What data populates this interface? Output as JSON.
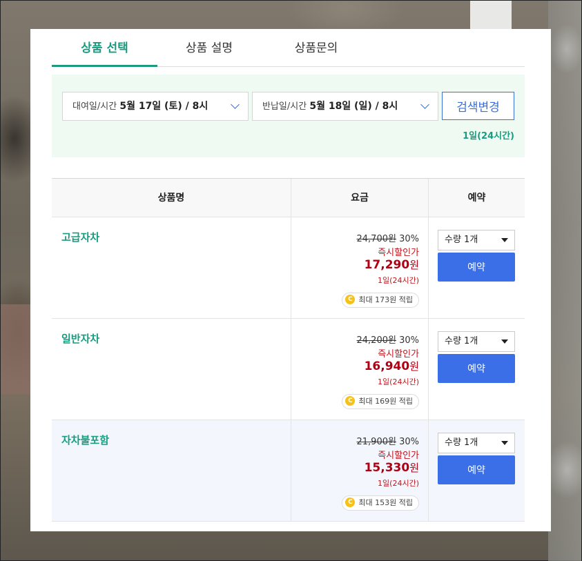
{
  "tabs": [
    {
      "label": "상품 선택"
    },
    {
      "label": "상품 설명"
    },
    {
      "label": "상품문의"
    }
  ],
  "search": {
    "from_label": "대여일/시간",
    "from_value": "5월 17일 (토) / 8시",
    "to_label": "반납일/시간",
    "to_value": "5월 18일 (일) / 8시",
    "change_button": "검색변경",
    "duration": "1일(24시간)"
  },
  "table": {
    "headers": [
      "상품명",
      "요금",
      "예약"
    ],
    "rows": [
      {
        "name": "고급자차",
        "original_price": "24,700원",
        "discount": "30%",
        "instant_label": "즉시할인가",
        "price": "17,290",
        "won": "원",
        "duration": "1일(24시간)",
        "points": "최대 173원 적립",
        "qty": "수량 1개",
        "book": "예약"
      },
      {
        "name": "일반자차",
        "original_price": "24,200원",
        "discount": "30%",
        "instant_label": "즉시할인가",
        "price": "16,940",
        "won": "원",
        "duration": "1일(24시간)",
        "points": "최대 169원 적립",
        "qty": "수량 1개",
        "book": "예약"
      },
      {
        "name": "자차불포함",
        "original_price": "21,900원",
        "discount": "30%",
        "instant_label": "즉시할인가",
        "price": "15,330",
        "won": "원",
        "duration": "1일(24시간)",
        "points": "최대 153원 적립",
        "qty": "수량 1개",
        "book": "예약"
      }
    ]
  },
  "coin_glyph": "C",
  "colors": {
    "accent_green": "#1a9b80",
    "button_blue": "#3b6fe8",
    "price_red": "#b00012",
    "search_bg": "#effaf2"
  }
}
